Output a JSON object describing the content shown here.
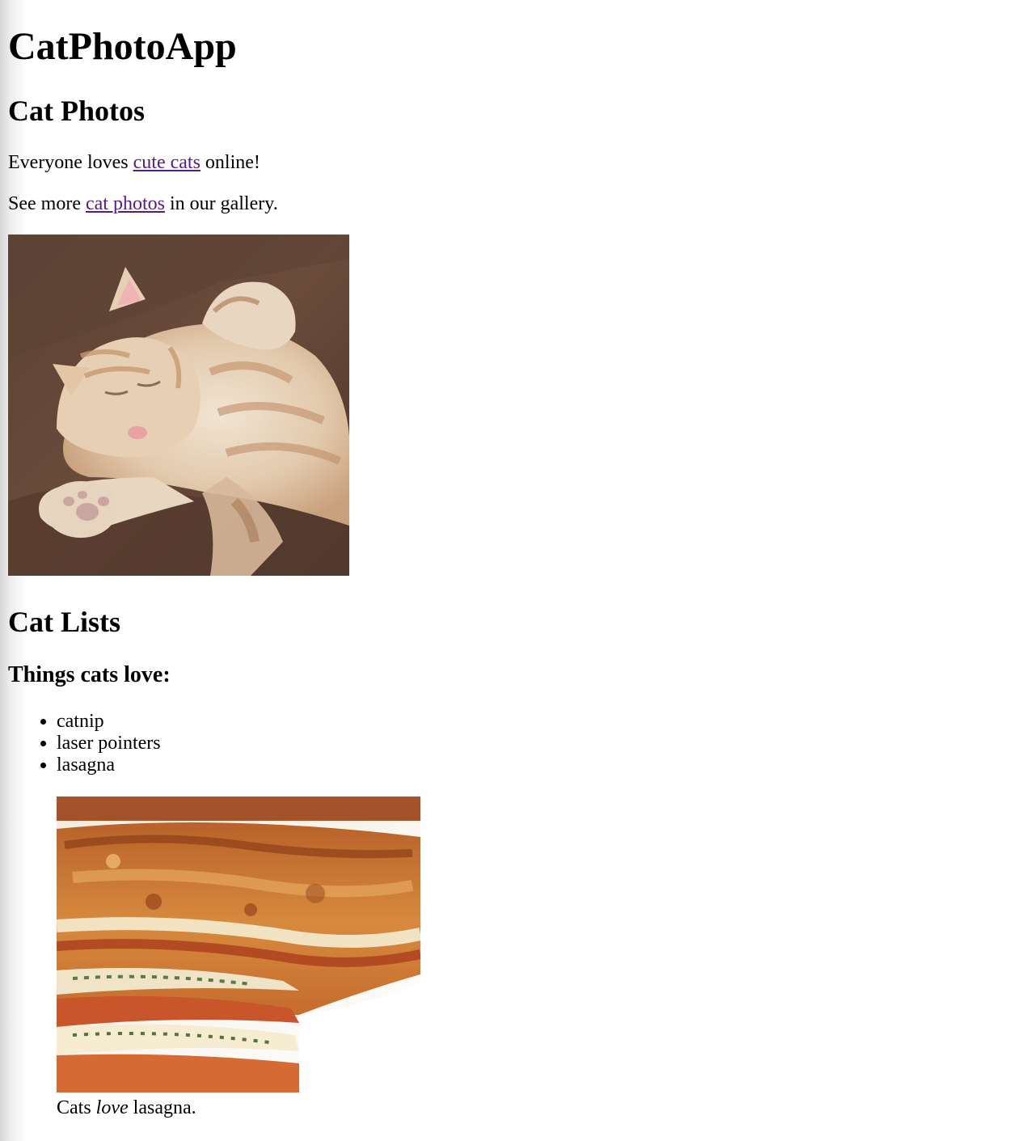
{
  "app": {
    "title": "CatPhotoApp"
  },
  "photos_section": {
    "heading": "Cat Photos",
    "line1": {
      "before": "Everyone loves ",
      "link": "cute cats",
      "after": " online!"
    },
    "line2": {
      "before": "See more ",
      "link": "cat photos",
      "after": " in our gallery."
    }
  },
  "lists_section": {
    "heading": "Cat Lists",
    "subheading": "Things cats love:",
    "items": [
      "catnip",
      "laser pointers",
      "lasagna"
    ],
    "caption": {
      "before": "Cats ",
      "emphasis": "love",
      "after": " lasagna."
    }
  },
  "colors": {
    "link_visited": "#551a8b",
    "background": "#ffffff"
  }
}
